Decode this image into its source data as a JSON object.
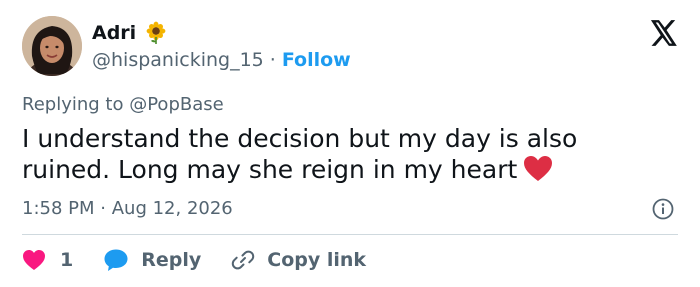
{
  "user": {
    "name": "Adri",
    "handle": "@hispanicking_15",
    "separator": "·",
    "follow_label": "Follow",
    "name_emoji": "sunflower-icon"
  },
  "reply_context": {
    "prefix": "Replying to",
    "mention": "@PopBase"
  },
  "tweet": {
    "text": "I understand the decision but my day is also ruined. Long may she reign in my heart",
    "trailing_emoji": "red-heart-icon"
  },
  "meta": {
    "time": "1:58 PM",
    "separator": "·",
    "date": "Aug 12, 2026"
  },
  "actions": {
    "like_count": "1",
    "reply_label": "Reply",
    "copy_label": "Copy link"
  },
  "colors": {
    "text": "#0f1419",
    "secondary": "#536471",
    "link": "#1d9bf0",
    "like": "#f91880",
    "divider": "#cfd9de"
  }
}
